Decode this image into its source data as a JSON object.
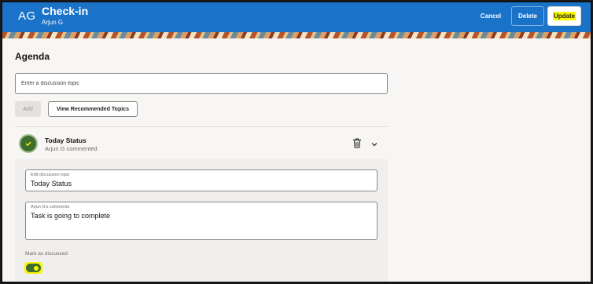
{
  "header": {
    "initials": "AG",
    "title": "Check-in",
    "subtitle": "Arjun G",
    "buttons": {
      "cancel": "Cancel",
      "delete": "Delete",
      "update": "Update"
    }
  },
  "colors": {
    "brand_blue": "#1a73c9",
    "highlight": "#f7f700",
    "toggle_on": "#3f6d2f"
  },
  "agenda": {
    "heading": "Agenda",
    "topic_input_placeholder": "Enter a discussion topic",
    "add_label": "Add",
    "recommended_label": "View Recommended Topics",
    "items": [
      {
        "title": "Today Status",
        "subtitle": "Arjun G commented",
        "icon": "checkmark-icon",
        "edit_topic_label": "Edit discussion topic",
        "edit_topic_value": "Today Status",
        "comments_label": "Arjun G's comments",
        "comments_value": "Task is going to complete",
        "mark_label": "Mark as discussed",
        "discussed": true
      }
    ]
  }
}
